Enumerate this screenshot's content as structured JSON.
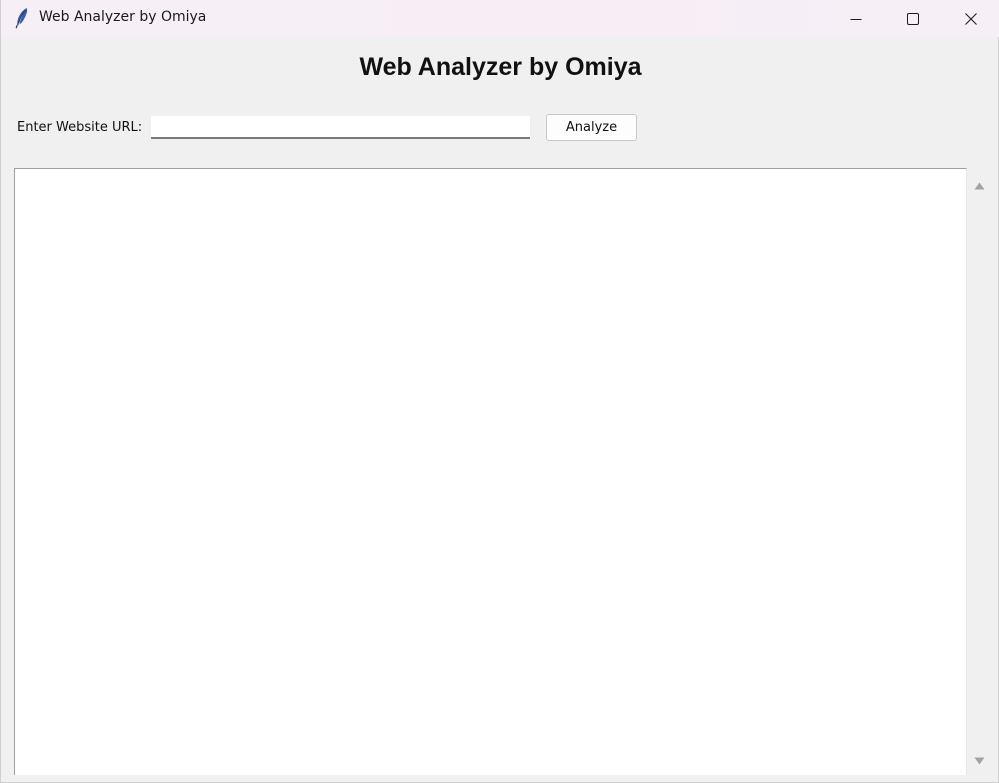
{
  "window": {
    "title": "Web Analyzer by Omiya",
    "icon": "feather-icon",
    "controls": {
      "minimize_icon": "minimize-icon",
      "maximize_icon": "maximize-icon",
      "close_icon": "close-icon"
    }
  },
  "header": {
    "title": "Web Analyzer by Omiya"
  },
  "form": {
    "url_label": "Enter Website URL:",
    "url_value": "",
    "url_placeholder": "",
    "analyze_label": "Analyze"
  },
  "output": {
    "text": ""
  },
  "colors": {
    "background": "#f0f0f0",
    "titlebar": "#f7eef5",
    "output_bg": "#ffffff"
  }
}
